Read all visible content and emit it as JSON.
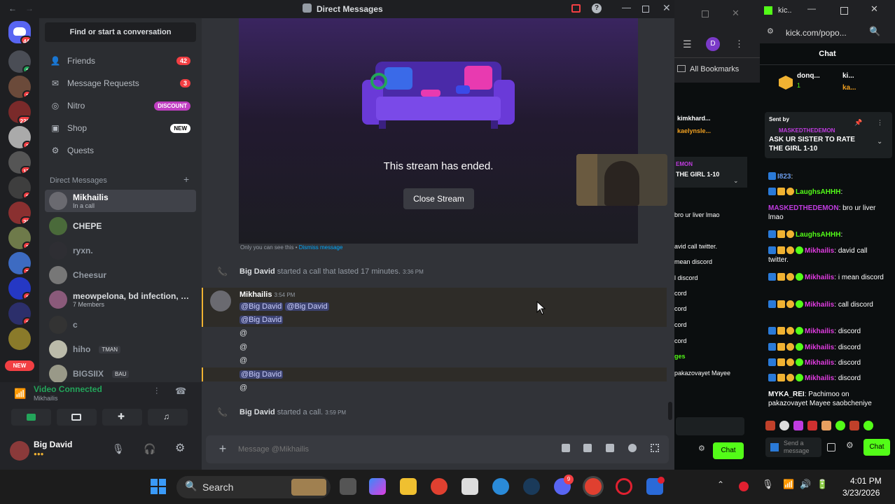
{
  "discord": {
    "window_title": "Direct Messages",
    "find_conversation": "Find or start a conversation",
    "nav": [
      {
        "label": "Friends",
        "badge": "42"
      },
      {
        "label": "Message Requests",
        "badge": "3"
      },
      {
        "label": "Nitro",
        "pill": "DISCOUNT"
      },
      {
        "label": "Shop",
        "pill": "NEW"
      },
      {
        "label": "Quests"
      }
    ],
    "dm_header": "Direct Messages",
    "dms": [
      {
        "name": "Mikhailis",
        "status": "In a call"
      },
      {
        "name": "CHEPE"
      },
      {
        "name": "ryxn."
      },
      {
        "name": "Cheesur"
      },
      {
        "name": "meowpelona, bd infection, N...",
        "status": "7 Members"
      },
      {
        "name": "c"
      },
      {
        "name": "hiho",
        "tag": "TMAN"
      },
      {
        "name": "BIGSIIX",
        "tag": "BAU"
      }
    ],
    "server_badges": [
      "44",
      "1",
      "226",
      "17",
      "2",
      "20",
      "1",
      "1",
      "7",
      "1",
      "1"
    ],
    "new_label": "NEW",
    "voice_status": "Video Connected",
    "voice_user": "Mikhailis",
    "current_user": "Big David",
    "stream_ended": "This stream has ended.",
    "close_stream": "Close Stream",
    "only_you": "Only you can see this •",
    "dismiss": "Dismiss message",
    "call1_user": "Big David",
    "call1_text": "started a call that lasted 17 minutes.",
    "call1_time": "3:36 PM",
    "msg_author": "Mikhailis",
    "msg_time": "3:54 PM",
    "mention": "@Big David",
    "at": "@",
    "call2_user": "Big David",
    "call2_text": "started a call.",
    "call2_time": "3:59 PM",
    "composer_placeholder": "Message @Mikhailis"
  },
  "middle": {
    "avatar_letter": "D",
    "bookmarks": "All Bookmarks",
    "chat_users": [
      "kimkhard...",
      "kaelynsle..."
    ],
    "pinned": "THE GIRL 1-10",
    "pinned_tag": "EMON",
    "lines": [
      "bro ur liver lmao",
      "avid call twitter.",
      "mean discord",
      "l discord",
      "cord",
      "cord",
      "cord",
      "cord"
    ],
    "messages_label": "ges",
    "last_line": "pakazovayet Mayee",
    "chat_btn": "Chat"
  },
  "kick": {
    "tab": "kic..",
    "url": "kick.com/popo...",
    "chat_title": "Chat",
    "top_user": "donq...",
    "top_count": "1",
    "top_right": [
      "ki...",
      "ka..."
    ],
    "sent_by": "Sent by",
    "pin_user": "MASKEDTHEDEMON",
    "pin_text": "ASK UR SISTER TO RATE THE GIRL 1-10",
    "lines": [
      {
        "user": "I823",
        "text": ""
      },
      {
        "user": "LaughsAHHH",
        "text": ""
      },
      {
        "user": "MASKEDTHEDEMON",
        "text": "bro ur liver lmao"
      },
      {
        "user": "LaughsAHHH",
        "text": ""
      },
      {
        "user": "Mikhailis",
        "text": "david call twitter."
      },
      {
        "user": "Mikhailis",
        "text": "i mean discord"
      },
      {
        "user": "Mikhailis",
        "text": "call discord"
      },
      {
        "user": "Mikhailis",
        "text": "discord"
      },
      {
        "user": "Mikhailis",
        "text": "discord"
      },
      {
        "user": "Mikhailis",
        "text": "discord"
      },
      {
        "user": "Mikhailis",
        "text": "discord"
      },
      {
        "user": "MYKA_REI",
        "text": "Pachimoo on pakazovayet Mayee saobcheniye"
      }
    ],
    "send_placeholder": "Send a message",
    "chat_btn": "Chat"
  },
  "taskbar": {
    "search": "Search",
    "time": "4:01 PM",
    "date": "3/23/2026",
    "discord_badge": "9"
  },
  "colors": {
    "accent": "#5865f2",
    "kick_green": "#53fc18",
    "red": "#f23f43",
    "green": "#23a55a"
  }
}
